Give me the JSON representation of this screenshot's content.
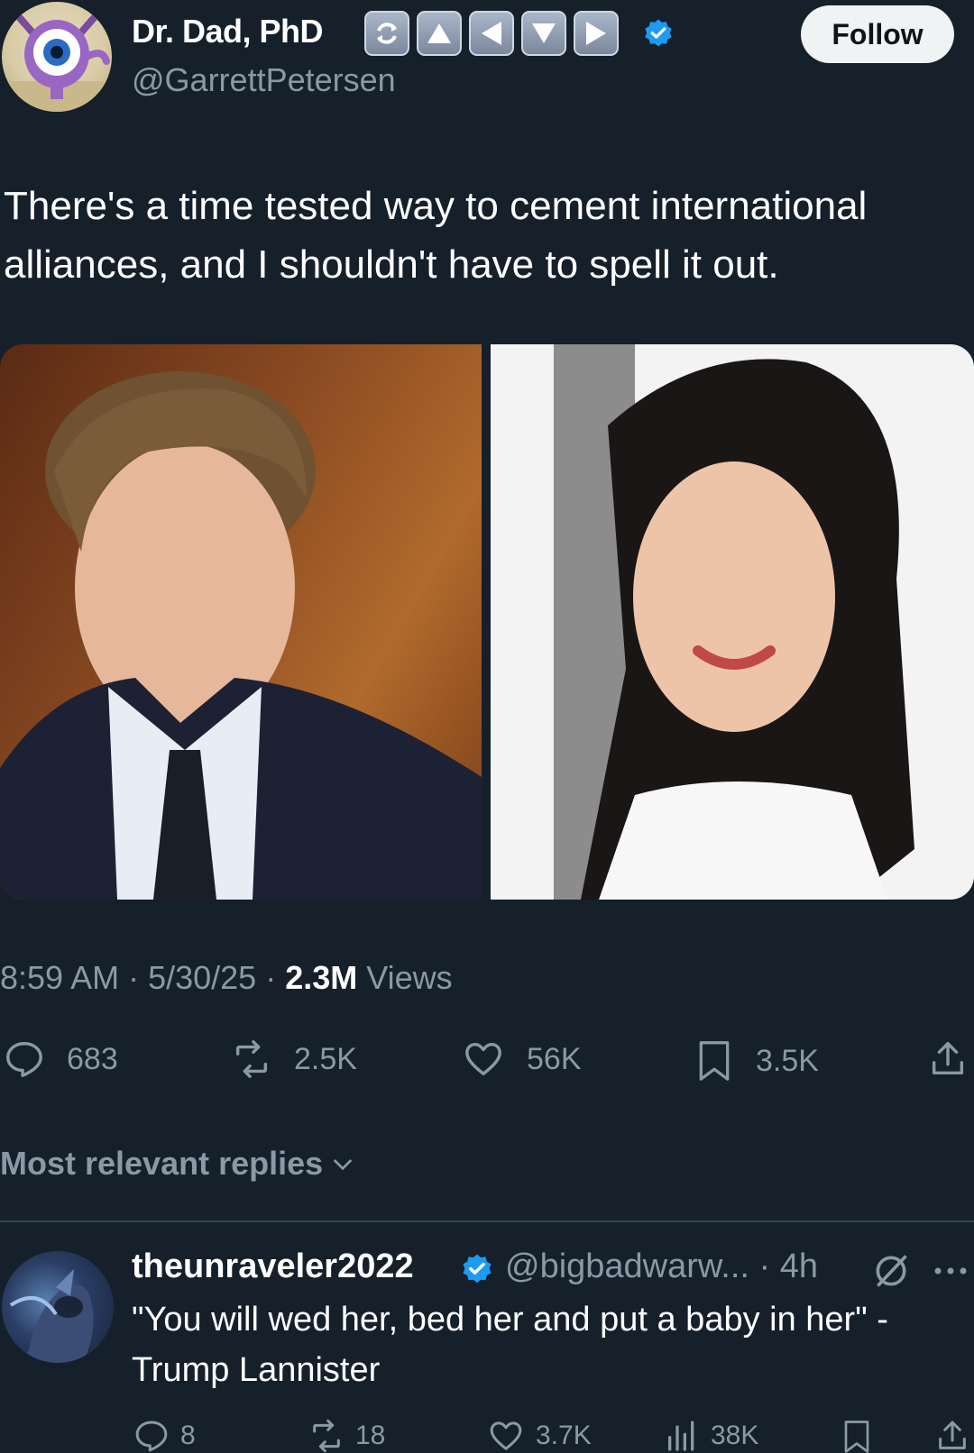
{
  "author": {
    "display_name": "Dr. Dad, PhD",
    "handle": "@GarrettPetersen",
    "badges": [
      "refresh-icon",
      "arrow-up-icon",
      "arrow-left-icon",
      "arrow-down-icon",
      "arrow-right-icon"
    ],
    "verified": true
  },
  "follow_button": {
    "label": "Follow"
  },
  "tweet": {
    "text": "There's a time tested way to cement international alliances, and I shouldn't have to spell it out."
  },
  "meta": {
    "time_date": "8:59 AM · 5/30/25 · ",
    "views_count": "2.3M",
    "views_label": " Views"
  },
  "actions": {
    "replies": "683",
    "reposts": "2.5K",
    "likes": "56K",
    "bookmarks": "3.5K"
  },
  "replies_sort": {
    "label": "Most relevant replies"
  },
  "reply": {
    "display_name": "theunraveler2022",
    "handle_time": "@bigbadwarw... · 4h",
    "text": "\"You will wed her, bed her and put a baby in her\" - Trump Lannister",
    "actions": {
      "replies": "8",
      "reposts": "18",
      "likes": "3.7K",
      "views": "38K"
    }
  },
  "colors": {
    "background": "#15202b",
    "muted": "#8b98a5",
    "verified": "#1d9bf0",
    "divider": "#38444d"
  }
}
